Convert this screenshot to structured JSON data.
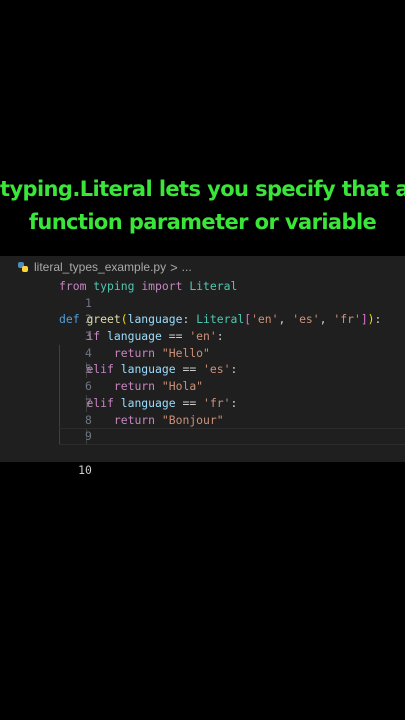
{
  "caption": {
    "line1": "typing.Literal lets you specify that a",
    "line2": "function parameter or variable"
  },
  "editor": {
    "breadcrumb": {
      "file": "literal_types_example.py",
      "separator": ">",
      "more": "..."
    },
    "line_numbers": [
      "1",
      "2",
      "3",
      "4",
      "5",
      "6",
      "7",
      "8",
      "9",
      "10"
    ],
    "code": {
      "l1": {
        "from": "from",
        "module": "typing",
        "import": "import",
        "name": "Literal"
      },
      "l3": {
        "def": "def",
        "fn": "greet",
        "open": "(",
        "param": "language",
        "colon": ": ",
        "type": "Literal",
        "lb": "[",
        "s1": "'en'",
        "c1": ", ",
        "s2": "'es'",
        "c2": ", ",
        "s3": "'fr'",
        "rb": "]",
        "close": ")",
        "end": ":"
      },
      "l4": {
        "kw": "if",
        "var": "language",
        "op": " == ",
        "str": "'en'",
        "end": ":"
      },
      "l5": {
        "kw": "return",
        "str": "\"Hello\""
      },
      "l6": {
        "kw": "elif",
        "var": "language",
        "op": " == ",
        "str": "'es'",
        "end": ":"
      },
      "l7": {
        "kw": "return",
        "str": "\"Hola\""
      },
      "l8": {
        "kw": "elif",
        "var": "language",
        "op": " == ",
        "str": "'fr'",
        "end": ":"
      },
      "l9": {
        "kw": "return",
        "str": "\"Bonjour\""
      }
    }
  },
  "colors": {
    "caption": "#39e639",
    "editor_bg": "#1f1f1f",
    "keyword": "#c586c0",
    "string": "#ce9178",
    "function": "#dcdcaa",
    "type": "#4ec9b0",
    "variable": "#9cdcfe"
  }
}
